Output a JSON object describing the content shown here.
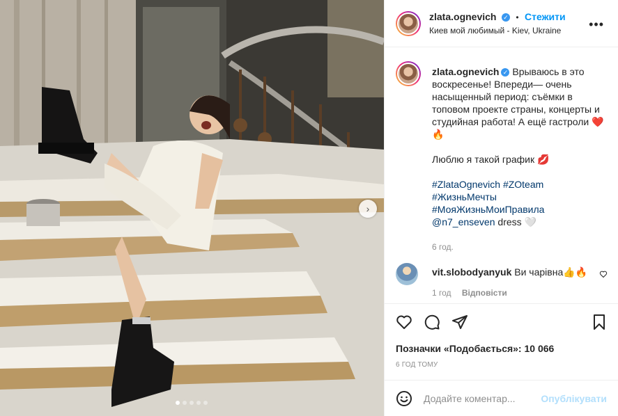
{
  "post": {
    "username": "zlata.ognevich",
    "verified_icon": "verified-badge-icon",
    "follow_label": "Стежити",
    "separator": "•",
    "location": "Киев мой любимый - Kiev, Ukraine",
    "more_icon": "more-options-icon",
    "more_label": "•••"
  },
  "caption": {
    "username": "zlata.ognevich",
    "text": "Врываюсь в это воскресенье! Впереди— очень насыщенный период: съёмки в топовом проекте страны, концерты и студийная работа! А ещё гастроли ❤️🔥",
    "line2": "Люблю я такой график 💋",
    "hashtags": [
      "#ZlataOgnevich #ZOteam",
      "#ЖизньМечты",
      "#МояЖизньМоиПравила"
    ],
    "mention": "@n7_enseven",
    "mention_suffix": " dress 🤍",
    "time": "6 год."
  },
  "comment": {
    "username": "vit.slobodyanyuk",
    "text": "Ви чарівна👍🔥",
    "time": "1 год",
    "reply_label": "Відповісти"
  },
  "actions": {
    "likes_text": "Позначки «Подобається»: 10 066",
    "post_time": "6 ГОД ТОМУ"
  },
  "comment_box": {
    "placeholder": "Додайте коментар...",
    "publish_label": "Опублікувати"
  },
  "carousel": {
    "next_icon": "chevron-right-icon",
    "next_label": "›",
    "dots_total": 5,
    "active_dot": 1
  },
  "colors": {
    "link": "#00376b",
    "follow": "#0095f6",
    "publish_disabled": "#b2dffc",
    "muted": "#8e8e8e"
  }
}
